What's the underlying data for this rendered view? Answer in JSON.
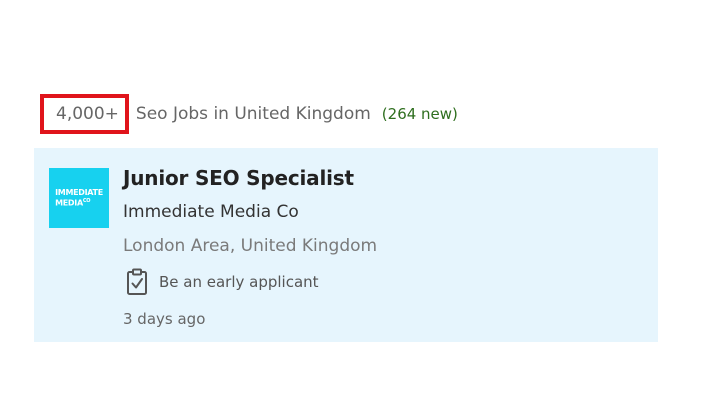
{
  "results": {
    "count": "4,000+",
    "heading": "Seo Jobs in United Kingdom",
    "new_count": "(264 new)"
  },
  "job": {
    "logo_text_line1": "IMMEDIATE",
    "logo_text_line2": "MEDIA",
    "logo_text_sup": "CO",
    "title": "Junior SEO Specialist",
    "company": "Immediate Media Co",
    "location": "London Area, United Kingdom",
    "insight": "Be an early applicant",
    "insight_icon": "clipboard-check-icon",
    "posted": "3 days ago"
  },
  "colors": {
    "highlight_border": "#e0141b",
    "card_background": "#e6f5fd",
    "logo_background": "#17d1ef",
    "new_count_text": "#2e6e1e"
  }
}
